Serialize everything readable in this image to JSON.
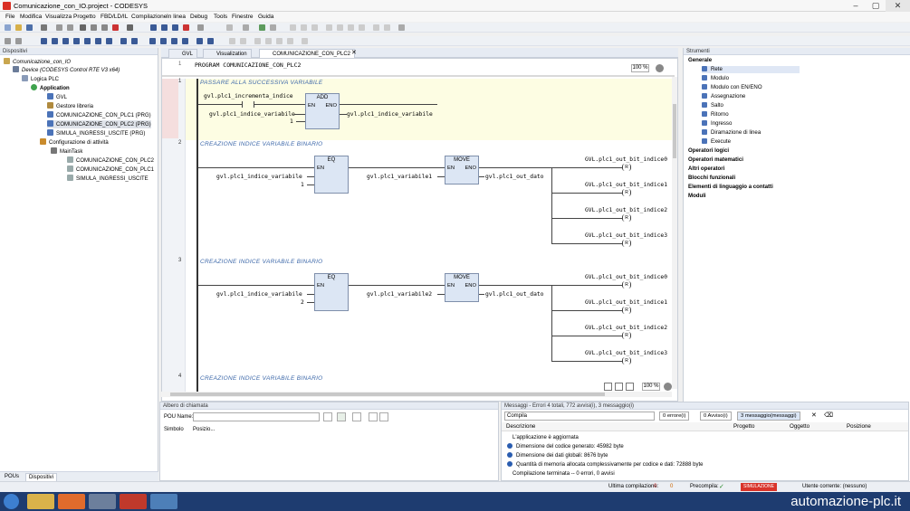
{
  "window": {
    "title": "Comunicazione_con_IO.project - CODESYS"
  },
  "menu": [
    "File",
    "Modifica",
    "Visualizza",
    "Progetto",
    "FBD/LD/IL",
    "Compilazione",
    "In linea",
    "Debug",
    "Tools",
    "Finestre",
    "Guida"
  ],
  "devices": {
    "header": "Dispositivi",
    "tree": [
      "Comunicazione_con_IO",
      "Device (CODESYS Control RTE V3 x64)",
      "Logica PLC",
      "Application",
      "GVL",
      "Gestore libreria",
      "COMUNICAZIONE_CON_PLC1 (PRG)",
      "COMUNICAZIONE_CON_PLC2 (PRG)",
      "SIMULA_INGRESSI_USCITE (PRG)",
      "Configurazione di attività",
      "MainTask",
      "COMUNICAZIONE_CON_PLC2",
      "COMUNICAZIONE_CON_PLC1",
      "SIMULA_INGRESSI_USCITE"
    ],
    "tabs": [
      "POUs",
      "Dispositivi"
    ]
  },
  "editor": {
    "tabs": [
      "GVL",
      "Visualization",
      "COMUNICAZIONE_CON_PLC2"
    ],
    "program_decl": "PROGRAM COMUNICAZIONE_CON_PLC2",
    "zoom_top": "100 %",
    "zoom_bottom": "100 %",
    "networks": [
      {
        "num": "1",
        "comment": "PASSARE ALLA SUCCESSIVA VARIABILE",
        "contact": "gvl.plc1_incrementa_indice",
        "block": "ADD",
        "in1": "gvl.plc1_indice_variabile",
        "in2": "1",
        "out": "gvl.plc1_indice_variabile",
        "en": "EN",
        "eno": "ENO"
      },
      {
        "num": "2",
        "comment": "CREAZIONE INDICE VARIABILE BINARIO",
        "eq": "EQ",
        "in1": "gvl.plc1_indice_variabile",
        "in2": "1",
        "move": "MOVE",
        "move_in": "gvl.plc1_variabile1",
        "move_out": "gvl.plc1_out_dato",
        "coils": [
          "GVL.plc1_out_bit_indice0",
          "GVL.plc1_out_bit_indice1",
          "GVL.plc1_out_bit_indice2",
          "GVL.plc1_out_bit_indice3"
        ],
        "coil_mark": "R"
      },
      {
        "num": "3",
        "comment": "CREAZIONE INDICE VARIABILE BINARIO",
        "eq": "EQ",
        "in1": "gvl.plc1_indice_variabile",
        "in2": "2",
        "move": "MOVE",
        "move_in": "gvl.plc1_variabile2",
        "move_out": "gvl.plc1_out_dato",
        "coils": [
          "GVL.plc1_out_bit_indice0",
          "GVL.plc1_out_bit_indice1",
          "GVL.plc1_out_bit_indice2",
          "GVL.plc1_out_bit_indice3"
        ],
        "coil_mark": "R"
      },
      {
        "num": "4",
        "comment": "CREAZIONE INDICE VARIABILE BINARIO"
      }
    ]
  },
  "tools": {
    "header": "Strumenti",
    "sections": [
      "Generale",
      "Operatori logici",
      "Operatori matematici",
      "Altri operatori",
      "Blocchi funzionali",
      "Elementi di linguaggio a contatti",
      "Moduli"
    ],
    "generale_items": [
      "Rete",
      "Modulo",
      "Modulo con EN/ENO",
      "Assegnazione",
      "Salto",
      "Ritorno",
      "Ingresso",
      "Diramazione di linea",
      "Execute"
    ]
  },
  "call_tree": {
    "header": "Albero di chiamata",
    "pou_label": "POU Name:",
    "cols": [
      "Simbolo",
      "Posizio..."
    ]
  },
  "messages": {
    "header": "Messaggi - Errori 4 totali, 772 avvisi(i), 3 messaggio(i)",
    "filter": "Compila",
    "errors": "0 errore(i)",
    "warnings": "0 Avviso(i)",
    "msgs": "3 messaggio(messaggi)",
    "cols": [
      "Descrizione",
      "Progetto",
      "Oggetto",
      "Posizione"
    ],
    "rows": [
      "L'applicazione è aggiornata",
      "Dimensione del codice generato: 45982 byte",
      "Dimensione dei dati globali: 8676 byte",
      "Quantità di memoria allocata complessivamente per codice e dati: 72888 byte",
      "Compilazione terminata -- 0 errori, 0 avvisi"
    ]
  },
  "status": {
    "last": "Ultima compilazione:",
    "e": "0",
    "w": "0",
    "precompile": "Precompila:",
    "sim": "SIMULAZIONE",
    "user": "Utente corrente: (nessuno)"
  },
  "brand": "automazione-plc.it",
  "colors": {
    "accent": "#3d68a9",
    "comment": "#3d68a9",
    "network_highlight": "#fdfde3"
  }
}
